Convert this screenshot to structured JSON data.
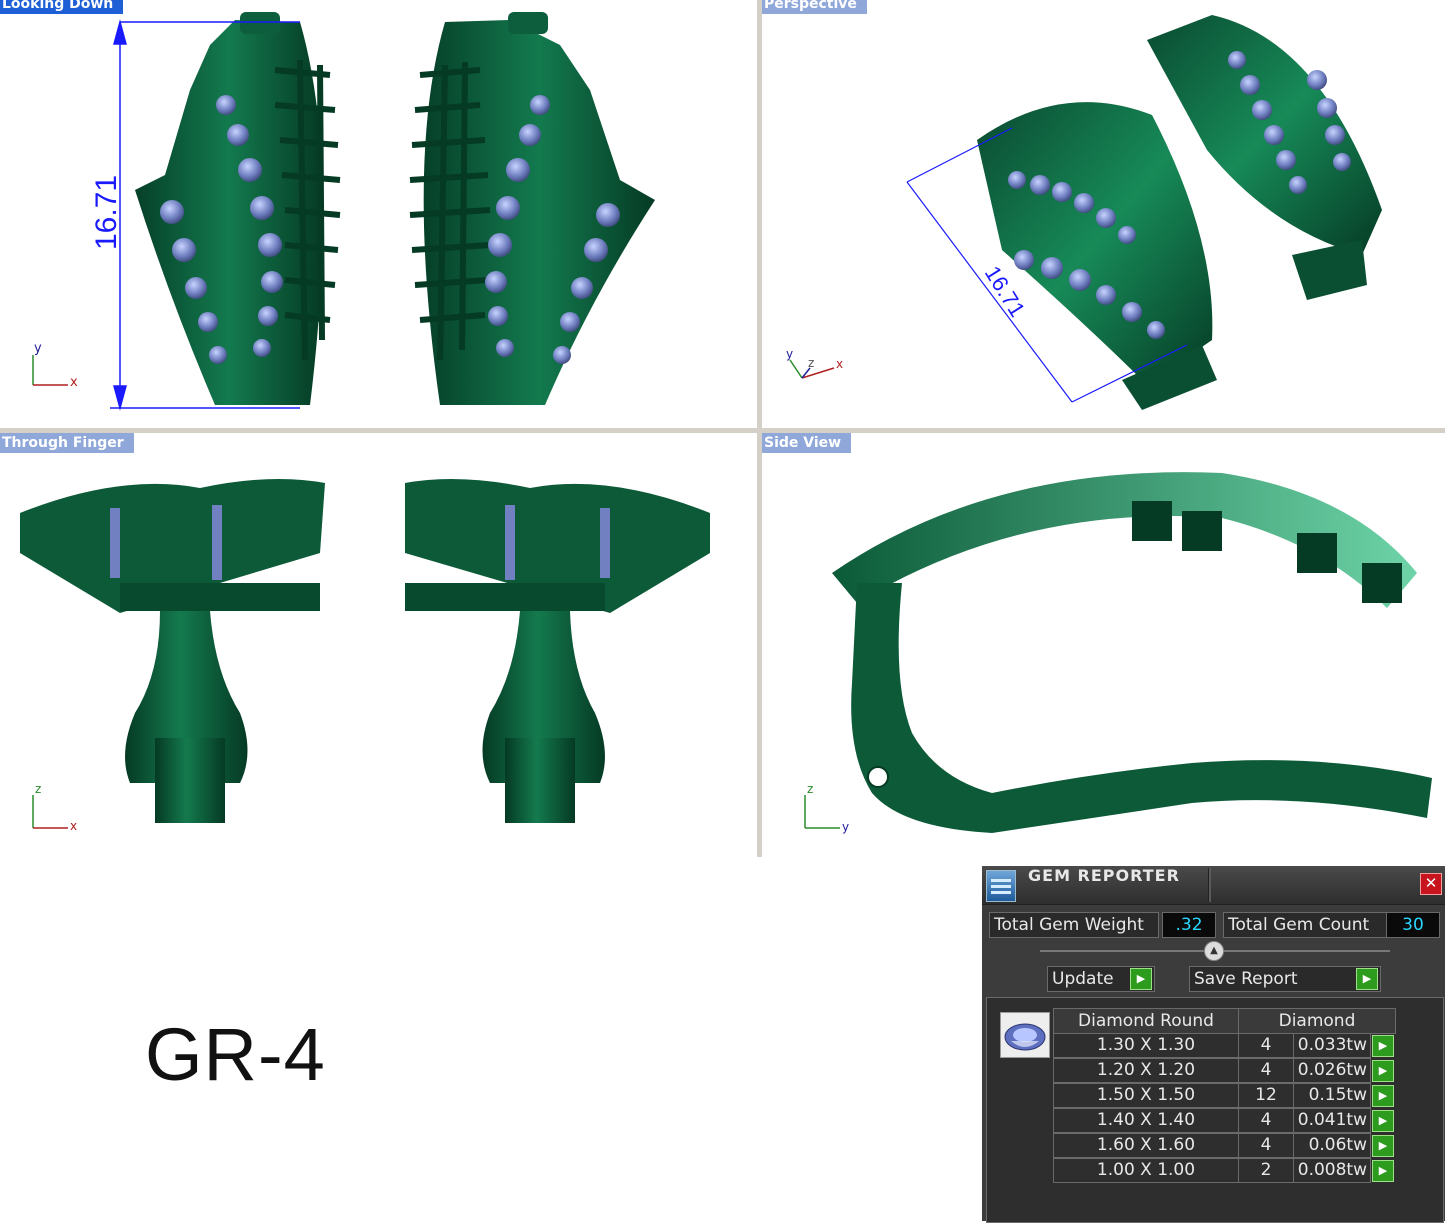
{
  "viewports": {
    "top_left_title": "Looking Down",
    "top_right_title": "Perspective",
    "bottom_left_title": "Through Finger",
    "bottom_right_title": "Side View",
    "dimension_label": "16.71",
    "title_color_active": "#1f5fd6",
    "title_color_inactive": "#8fa7d9",
    "model_color": "#0d5e3c"
  },
  "axes": {
    "x": "x",
    "y": "y",
    "z": "z"
  },
  "model_label": "GR-4",
  "gem_reporter": {
    "title": "GEM REPORTER",
    "close_glyph": "✕",
    "total_weight_label": "Total Gem Weight",
    "total_weight_value": ".32",
    "total_count_label": "Total Gem Count",
    "total_count_value": "30",
    "update_label": "Update",
    "save_report_label": "Save Report",
    "collapse_glyph": "▲",
    "go_glyph": "▶",
    "col_shape": "Diamond Round",
    "col_material": "Diamond",
    "rows": [
      {
        "size": "1.30 X 1.30",
        "count": "4",
        "weight": "0.033tw"
      },
      {
        "size": "1.20 X 1.20",
        "count": "4",
        "weight": "0.026tw"
      },
      {
        "size": "1.50 X 1.50",
        "count": "12",
        "weight": "0.15tw"
      },
      {
        "size": "1.40 X 1.40",
        "count": "4",
        "weight": "0.041tw"
      },
      {
        "size": "1.60 X 1.60",
        "count": "4",
        "weight": "0.06tw"
      },
      {
        "size": "1.00 X 1.00",
        "count": "2",
        "weight": "0.008tw"
      }
    ]
  }
}
